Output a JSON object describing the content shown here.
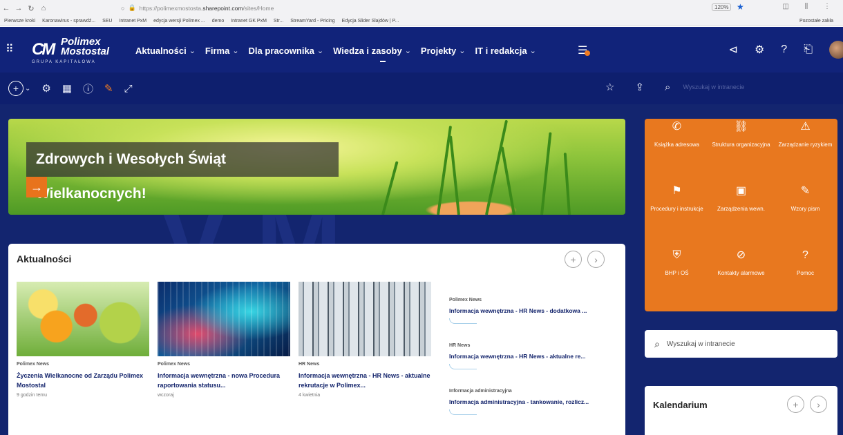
{
  "browser": {
    "url_prefix": "https://polimexmostosta",
    "url_domain": ".sharepoint.com",
    "url_suffix": "/sites/Home",
    "zoom": "120%",
    "bookmarks": [
      "Pierwsze kroki",
      "Karonawirus - sprawdź...",
      "SEU",
      "Intranet PxM",
      "edycja wersji Polimex ...",
      "demo",
      "Intranet GK PxM",
      "Str...",
      "StreamYard - Pricing",
      "Edycja Slider Slajdów | P..."
    ],
    "bookmarks_right": "Pozostałe zakła"
  },
  "suite": {
    "logo_mark": "CM",
    "logo_name_line1": "Polimex",
    "logo_name_line2": "Mostostal",
    "logo_sub": "GRUPA KAPITAŁOWA",
    "nav": [
      {
        "label": "Aktualności"
      },
      {
        "label": "Firma"
      },
      {
        "label": "Dla pracownika"
      },
      {
        "label": "Wiedza i zasoby"
      },
      {
        "label": "Projekty"
      },
      {
        "label": "IT i redakcja"
      }
    ]
  },
  "command_bar": {
    "search_placeholder": "Wyszukaj w intranecie"
  },
  "hero": {
    "title": "Zdrowych i Wesołych Świąt Wielkanocnych!",
    "arrow": "→"
  },
  "quick_links": [
    {
      "label": "Książka adresowa",
      "icon": "phone-icon",
      "glyph": "✆"
    },
    {
      "label": "Struktura organizacyjna",
      "icon": "org-chart-icon",
      "glyph": "⛓"
    },
    {
      "label": "Zarządzanie ryzykiem",
      "icon": "person-warning-icon",
      "glyph": "⚠"
    },
    {
      "label": "Procedury i instrukcje",
      "icon": "people-board-icon",
      "glyph": "⚑"
    },
    {
      "label": "Zarządzenia wewn.",
      "icon": "document-icon",
      "glyph": "▣"
    },
    {
      "label": "Wzory pism",
      "icon": "document-edit-icon",
      "glyph": "✎"
    },
    {
      "label": "BHP i OŚ",
      "icon": "shield-check-icon",
      "glyph": "⛨"
    },
    {
      "label": "Kontakty alarmowe",
      "icon": "shield-alert-icon",
      "glyph": "⊘"
    },
    {
      "label": "Pomoc",
      "icon": "question-icon",
      "glyph": "?"
    }
  ],
  "news": {
    "heading": "Aktualności",
    "cards": [
      {
        "category": "Polimex News",
        "title": "Życzenia Wielkanocne od Zarządu Polimex Mostostal",
        "date": "9 godzin temu"
      },
      {
        "category": "Polimex News",
        "title": "Informacja wewnętrzna - nowa Procedura raportowania statusu...",
        "date": "wczoraj"
      },
      {
        "category": "HR News",
        "title": "Informacja wewnętrzna - HR News - aktualne rekrutacje w Polimex...",
        "date": "4 kwietnia"
      }
    ],
    "list": [
      {
        "category": "Polimex News",
        "title": "Informacja wewnętrzna - HR News - dodatkowa ..."
      },
      {
        "category": "HR News",
        "title": "Informacja wewnętrzna - HR News - aktualne re..."
      },
      {
        "category": "Informacja administracyjna",
        "title": "Informacja administracyjna - tankowanie, rozlicz..."
      }
    ]
  },
  "sidebar_search": {
    "placeholder": "Wyszukaj w intranecie"
  },
  "kalendarium": {
    "heading": "Kalendarium"
  },
  "colors": {
    "suite_bar": "#11237a",
    "page_bg": "#13256f",
    "accent_orange": "#e8781f"
  }
}
